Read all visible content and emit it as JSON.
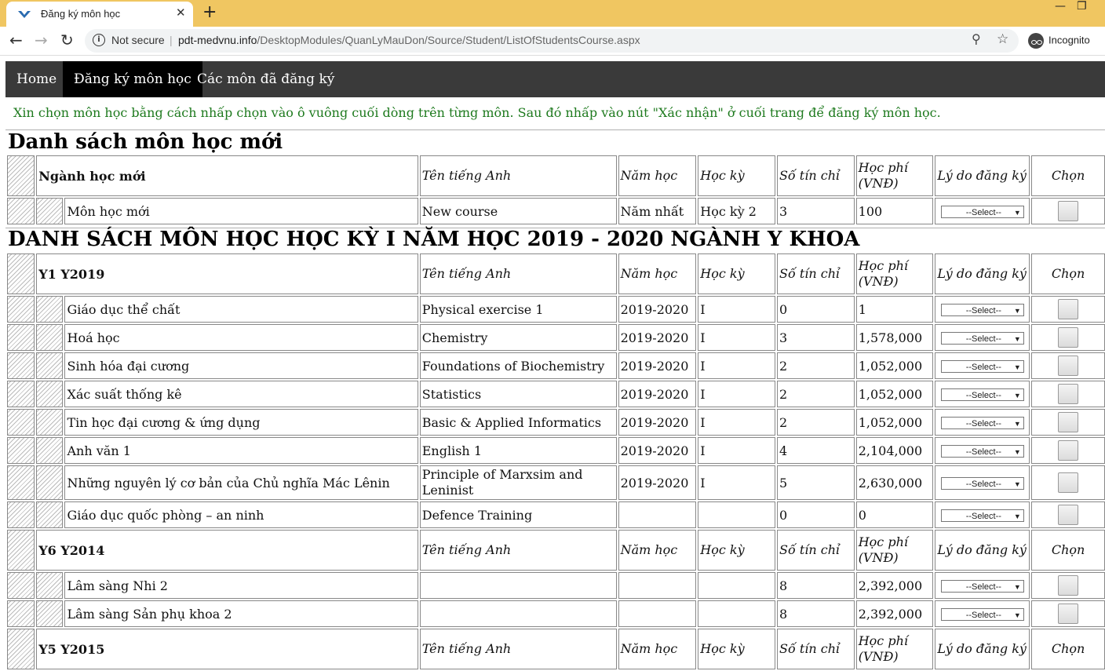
{
  "browser": {
    "tab_title": "Đăng ký môn học",
    "tab_close": "✕",
    "new_tab": "+",
    "not_secure": "Not secure",
    "url_domain": "pdt-medvnu.info",
    "url_path": "/DesktopModules/QuanLyMauDon/Source/Student/ListOfStudentsCourse.aspx",
    "profile": "Incognito"
  },
  "nav": {
    "items": [
      {
        "label": "Home"
      },
      {
        "label": "Đăng ký môn học"
      },
      {
        "label": "Các môn đã đăng ký"
      }
    ]
  },
  "notice": "Xin chọn môn học bằng cách nhấp chọn vào ô vuông cuối dòng trên từng môn. Sau đó nhấp vào nút \"Xác nhận\" ở cuối trang để đăng ký môn học.",
  "headers": {
    "ten_tieng_anh": "Tên tiếng Anh",
    "nam_hoc": "Năm học",
    "hoc_ky": "Học kỳ",
    "so_tin_chi": "Số tín chỉ",
    "hoc_phi": "Học phí (VNĐ)",
    "ly_do": "Lý do đăng ký",
    "chon": "Chọn"
  },
  "select_default": "--Select--",
  "section1": {
    "title": "Danh sách môn học mới",
    "group": "Ngành học mới",
    "rows": [
      {
        "name": "Môn học mới",
        "english": "New course",
        "year": "Năm nhất",
        "term": "Học kỳ 2",
        "credits": "3",
        "fee": "100"
      }
    ]
  },
  "section2": {
    "title": "DANH SÁCH MÔN HỌC HỌC KỲ I NĂM HỌC 2019 - 2020 NGÀNH Y KHOA",
    "groups": [
      {
        "name": "Y1 Y2019",
        "rows": [
          {
            "name": "Giáo dục thể chất",
            "english": "Physical exercise 1",
            "year": "2019-2020",
            "term": "I",
            "credits": "0",
            "fee": "1"
          },
          {
            "name": "Hoá học",
            "english": "Chemistry",
            "year": "2019-2020",
            "term": "I",
            "credits": "3",
            "fee": "1,578,000"
          },
          {
            "name": "Sinh hóa đại cương",
            "english": "Foundations of Biochemistry",
            "year": "2019-2020",
            "term": "I",
            "credits": "2",
            "fee": "1,052,000"
          },
          {
            "name": "Xác suất thống kê",
            "english": "Statistics",
            "year": "2019-2020",
            "term": "I",
            "credits": "2",
            "fee": "1,052,000"
          },
          {
            "name": "Tin học đại cương & ứng dụng",
            "english": "Basic & Applied Informatics",
            "year": "2019-2020",
            "term": "I",
            "credits": "2",
            "fee": "1,052,000"
          },
          {
            "name": "Anh văn 1",
            "english": "English 1",
            "year": "2019-2020",
            "term": "I",
            "credits": "4",
            "fee": "2,104,000"
          },
          {
            "name": "Những nguyên lý cơ bản của Chủ nghĩa Mác Lênin",
            "english": "Principle of Marxsim and Leninist",
            "year": "2019-2020",
            "term": "I",
            "credits": "5",
            "fee": "2,630,000"
          },
          {
            "name": "Giáo dục quốc phòng – an ninh",
            "english": "Defence Training",
            "year": "",
            "term": "",
            "credits": "0",
            "fee": "0"
          }
        ]
      },
      {
        "name": "Y6 Y2014",
        "rows": [
          {
            "name": "Lâm sàng Nhi 2",
            "english": "",
            "year": "",
            "term": "",
            "credits": "8",
            "fee": "2,392,000"
          },
          {
            "name": "Lâm sàng Sản phụ khoa 2",
            "english": "",
            "year": "",
            "term": "",
            "credits": "8",
            "fee": "2,392,000"
          }
        ]
      },
      {
        "name": "Y5 Y2015",
        "rows": []
      }
    ]
  }
}
